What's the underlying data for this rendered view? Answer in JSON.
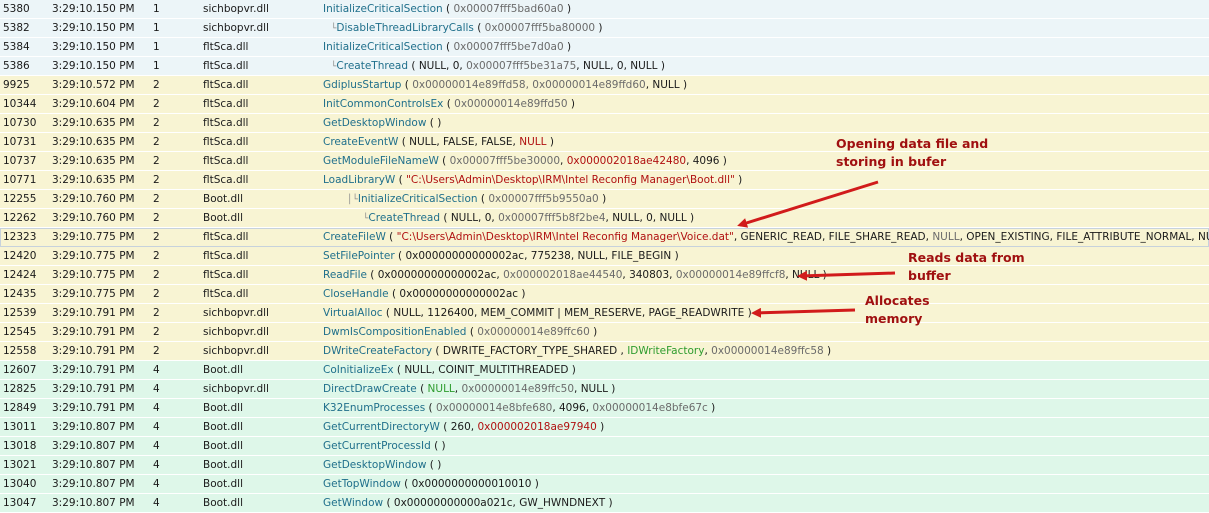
{
  "colors": {
    "thread1_row": "#ecf5f8",
    "thread2_row": "#f8f4d3",
    "thread4_row": "#def7e9",
    "function_name": "#1f6f8b",
    "pointer_value": "#b01010",
    "constant_value": "#2e9c2e",
    "annotation": "#a01010"
  },
  "rows": [
    {
      "id": "5380",
      "time": "3:29:10.150 PM",
      "thread": "1",
      "module": "sichbopvr.dll",
      "depth": 0,
      "func": "InitializeCriticalSection",
      "args": [
        {
          "t": "0x00007fff5bad60a0",
          "c": "dim"
        }
      ]
    },
    {
      "id": "5382",
      "time": "3:29:10.150 PM",
      "thread": "1",
      "module": "sichbopvr.dll",
      "depth": 1,
      "func": "DisableThreadLibraryCalls",
      "args": [
        {
          "t": "0x00007fff5ba80000",
          "c": "dim"
        }
      ]
    },
    {
      "id": "5384",
      "time": "3:29:10.150 PM",
      "thread": "1",
      "module": "fltSca.dll",
      "depth": 0,
      "func": "InitializeCriticalSection",
      "args": [
        {
          "t": "0x00007fff5be7d0a0",
          "c": "dim"
        }
      ]
    },
    {
      "id": "5386",
      "time": "3:29:10.150 PM",
      "thread": "1",
      "module": "fltSca.dll",
      "depth": 1,
      "func": "CreateThread",
      "args": [
        {
          "t": "NULL, 0, "
        },
        {
          "t": "0x00007fff5be31a75",
          "c": "dim"
        },
        {
          "t": ", NULL, 0, NULL"
        }
      ]
    },
    {
      "id": "9925",
      "time": "3:29:10.572 PM",
      "thread": "2",
      "module": "fltSca.dll",
      "depth": 0,
      "func": "GdiplusStartup",
      "args": [
        {
          "t": "0x00000014e89ffd58, 0x00000014e89ffd60",
          "c": "dim"
        },
        {
          "t": ", NULL"
        }
      ]
    },
    {
      "id": "10344",
      "time": "3:29:10.604 PM",
      "thread": "2",
      "module": "fltSca.dll",
      "depth": 0,
      "func": "InitCommonControlsEx",
      "args": [
        {
          "t": "0x00000014e89ffd50",
          "c": "dim"
        }
      ]
    },
    {
      "id": "10730",
      "time": "3:29:10.635 PM",
      "thread": "2",
      "module": "fltSca.dll",
      "depth": 0,
      "func": "GetDesktopWindow",
      "args": []
    },
    {
      "id": "10731",
      "time": "3:29:10.635 PM",
      "thread": "2",
      "module": "fltSca.dll",
      "depth": 0,
      "func": "CreateEventW",
      "args": [
        {
          "t": "NULL, FALSE, FALSE, "
        },
        {
          "t": "NULL",
          "c": "red"
        }
      ]
    },
    {
      "id": "10737",
      "time": "3:29:10.635 PM",
      "thread": "2",
      "module": "fltSca.dll",
      "depth": 0,
      "func": "GetModuleFileNameW",
      "args": [
        {
          "t": "0x00007fff5be30000",
          "c": "dim"
        },
        {
          "t": ", "
        },
        {
          "t": "0x000002018ae42480",
          "c": "red"
        },
        {
          "t": ", 4096"
        }
      ]
    },
    {
      "id": "10771",
      "time": "3:29:10.635 PM",
      "thread": "2",
      "module": "fltSca.dll",
      "depth": 0,
      "func": "LoadLibraryW",
      "args": [
        {
          "t": "\"C:\\Users\\Admin\\Desktop\\IRM\\Intel Reconfig Manager\\Boot.dll\"",
          "c": "red"
        }
      ]
    },
    {
      "id": "12255",
      "time": "3:29:10.760 PM",
      "thread": "2",
      "module": "Boot.dll",
      "depth": 2,
      "func": "InitializeCriticalSection",
      "args": [
        {
          "t": "0x00007fff5b9550a0",
          "c": "dim"
        }
      ]
    },
    {
      "id": "12262",
      "time": "3:29:10.760 PM",
      "thread": "2",
      "module": "Boot.dll",
      "depth": 3,
      "func": "CreateThread",
      "args": [
        {
          "t": "NULL, 0, "
        },
        {
          "t": "0x00007fff5b8f2be4",
          "c": "dim"
        },
        {
          "t": ", NULL, 0, NULL"
        }
      ]
    },
    {
      "id": "12323",
      "time": "3:29:10.775 PM",
      "thread": "2",
      "module": "fltSca.dll",
      "depth": 0,
      "func": "CreateFileW",
      "args": [
        {
          "t": "\"C:\\Users\\Admin\\Desktop\\IRM\\Intel Reconfig Manager\\Voice.dat\"",
          "c": "red"
        },
        {
          "t": ", GENERIC_READ, FILE_SHARE_READ, "
        },
        {
          "t": "NULL",
          "c": "dim"
        },
        {
          "t": ", OPEN_EXISTING, FILE_ATTRIBUTE_NORMAL, NULL"
        }
      ]
    },
    {
      "id": "12420",
      "time": "3:29:10.775 PM",
      "thread": "2",
      "module": "fltSca.dll",
      "depth": 0,
      "func": "SetFilePointer",
      "args": [
        {
          "t": "0x00000000000002ac, 775238, NULL, FILE_BEGIN"
        }
      ]
    },
    {
      "id": "12424",
      "time": "3:29:10.775 PM",
      "thread": "2",
      "module": "fltSca.dll",
      "depth": 0,
      "func": "ReadFile",
      "args": [
        {
          "t": "0x00000000000002ac, "
        },
        {
          "t": "0x000002018ae44540",
          "c": "dim"
        },
        {
          "t": ", 340803, "
        },
        {
          "t": "0x00000014e89ffcf8",
          "c": "dim"
        },
        {
          "t": ", NULL"
        }
      ]
    },
    {
      "id": "12435",
      "time": "3:29:10.775 PM",
      "thread": "2",
      "module": "fltSca.dll",
      "depth": 0,
      "func": "CloseHandle",
      "args": [
        {
          "t": "0x00000000000002ac"
        }
      ]
    },
    {
      "id": "12539",
      "time": "3:29:10.791 PM",
      "thread": "2",
      "module": "sichbopvr.dll",
      "depth": 0,
      "func": "VirtualAlloc",
      "args": [
        {
          "t": "NULL, 1126400, MEM_COMMIT | MEM_RESERVE, PAGE_READWRITE"
        }
      ]
    },
    {
      "id": "12545",
      "time": "3:29:10.791 PM",
      "thread": "2",
      "module": "sichbopvr.dll",
      "depth": 0,
      "func": "DwmIsCompositionEnabled",
      "args": [
        {
          "t": "0x00000014e89ffc60",
          "c": "dim"
        }
      ]
    },
    {
      "id": "12558",
      "time": "3:29:10.791 PM",
      "thread": "2",
      "module": "sichbopvr.dll",
      "depth": 0,
      "func": "DWriteCreateFactory",
      "args": [
        {
          "t": "DWRITE_FACTORY_TYPE_SHARED , "
        },
        {
          "t": "IDWriteFactory",
          "c": "green"
        },
        {
          "t": ", "
        },
        {
          "t": "0x00000014e89ffc58",
          "c": "dim"
        }
      ]
    },
    {
      "id": "12607",
      "time": "3:29:10.791 PM",
      "thread": "4",
      "module": "Boot.dll",
      "depth": 0,
      "func": "CoInitializeEx",
      "args": [
        {
          "t": "NULL, COINIT_MULTITHREADED"
        }
      ]
    },
    {
      "id": "12825",
      "time": "3:29:10.791 PM",
      "thread": "4",
      "module": "sichbopvr.dll",
      "depth": 0,
      "func": "DirectDrawCreate",
      "args": [
        {
          "t": "NULL",
          "c": "green"
        },
        {
          "t": ", "
        },
        {
          "t": "0x00000014e89ffc50",
          "c": "dim"
        },
        {
          "t": ", NULL"
        }
      ]
    },
    {
      "id": "12849",
      "time": "3:29:10.791 PM",
      "thread": "4",
      "module": "Boot.dll",
      "depth": 0,
      "func": "K32EnumProcesses",
      "args": [
        {
          "t": "0x00000014e8bfe680",
          "c": "dim"
        },
        {
          "t": ", 4096, "
        },
        {
          "t": "0x00000014e8bfe67c",
          "c": "dim"
        }
      ]
    },
    {
      "id": "13011",
      "time": "3:29:10.807 PM",
      "thread": "4",
      "module": "Boot.dll",
      "depth": 0,
      "func": "GetCurrentDirectoryW",
      "args": [
        {
          "t": "260, "
        },
        {
          "t": "0x000002018ae97940",
          "c": "red"
        }
      ]
    },
    {
      "id": "13018",
      "time": "3:29:10.807 PM",
      "thread": "4",
      "module": "Boot.dll",
      "depth": 0,
      "func": "GetCurrentProcessId",
      "args": []
    },
    {
      "id": "13021",
      "time": "3:29:10.807 PM",
      "thread": "4",
      "module": "Boot.dll",
      "depth": 0,
      "func": "GetDesktopWindow",
      "args": []
    },
    {
      "id": "13040",
      "time": "3:29:10.807 PM",
      "thread": "4",
      "module": "Boot.dll",
      "depth": 0,
      "func": "GetTopWindow",
      "args": [
        {
          "t": "0x0000000000010010"
        }
      ]
    },
    {
      "id": "13047",
      "time": "3:29:10.807 PM",
      "thread": "4",
      "module": "Boot.dll",
      "depth": 0,
      "func": "GetWindow",
      "args": [
        {
          "t": "0x00000000000a021c, GW_HWNDNEXT"
        }
      ]
    }
  ],
  "annotations": {
    "opening": {
      "line1": "Opening data file and",
      "line2": "storing in bufer"
    },
    "reads": {
      "line1": "Reads data from",
      "line2": "buffer"
    },
    "allocates": {
      "line1": "Allocates",
      "line2": "memory"
    }
  }
}
